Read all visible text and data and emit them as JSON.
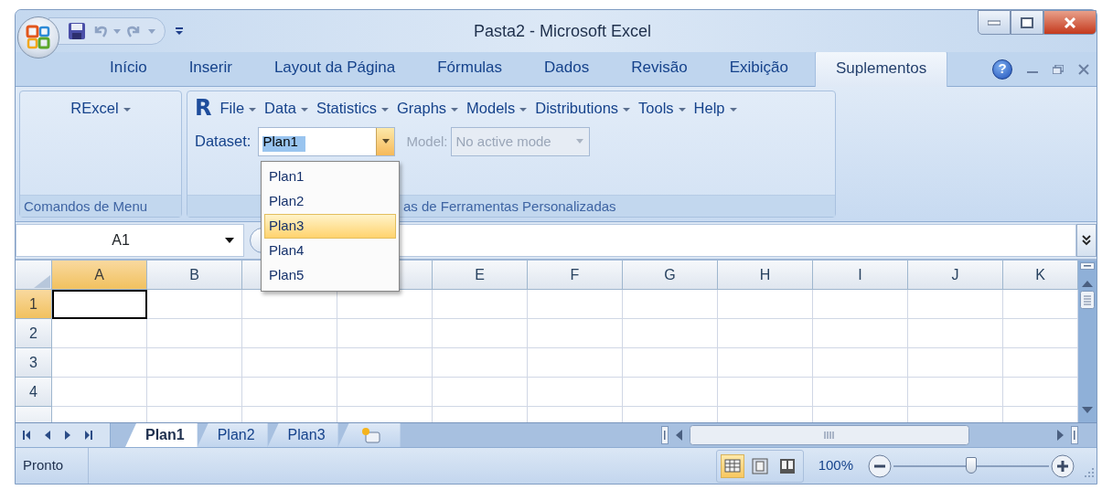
{
  "window": {
    "title": "Pasta2 - Microsoft Excel"
  },
  "help": {
    "glyph": "?"
  },
  "ribbon_tabs": [
    {
      "label": "Início",
      "selected": false
    },
    {
      "label": "Inserir",
      "selected": false
    },
    {
      "label": "Layout da Página",
      "selected": false
    },
    {
      "label": "Fórmulas",
      "selected": false
    },
    {
      "label": "Dados",
      "selected": false
    },
    {
      "label": "Revisão",
      "selected": false
    },
    {
      "label": "Exibição",
      "selected": false
    },
    {
      "label": "Suplementos",
      "selected": true
    }
  ],
  "menu_group": {
    "button": "RExcel",
    "label": "Comandos de Menu"
  },
  "tools_group": {
    "logo": "R",
    "menus": [
      {
        "label": "File"
      },
      {
        "label": "Data"
      },
      {
        "label": "Statistics"
      },
      {
        "label": "Graphs"
      },
      {
        "label": "Models"
      },
      {
        "label": "Distributions"
      },
      {
        "label": "Tools"
      },
      {
        "label": "Help"
      }
    ],
    "dataset": {
      "label": "Dataset:",
      "value": "Plan1",
      "highlighted": true
    },
    "model": {
      "label": "Model:",
      "value": "No active mode",
      "disabled": true
    },
    "label": "as de Ferramentas Personalizadas"
  },
  "dataset_dropdown": {
    "items": [
      {
        "label": "Plan1",
        "selected": false
      },
      {
        "label": "Plan2",
        "selected": false
      },
      {
        "label": "Plan3",
        "selected": true
      },
      {
        "label": "Plan4",
        "selected": false
      },
      {
        "label": "Plan5",
        "selected": false
      }
    ]
  },
  "name_box": {
    "value": "A1"
  },
  "grid": {
    "columns": [
      {
        "label": "A",
        "selected": true
      },
      {
        "label": "B",
        "selected": false
      },
      {
        "kind": "covered"
      },
      {
        "kind": "covered"
      },
      {
        "label": "E",
        "selected": false
      },
      {
        "label": "F",
        "selected": false
      },
      {
        "label": "G",
        "selected": false
      },
      {
        "label": "H",
        "selected": false
      },
      {
        "label": "I",
        "selected": false
      },
      {
        "label": "J",
        "selected": false
      },
      {
        "label": "K",
        "selected": false
      }
    ],
    "rows": [
      {
        "label": "1",
        "selected": true
      },
      {
        "label": "2",
        "selected": false
      },
      {
        "label": "3",
        "selected": false
      },
      {
        "label": "4",
        "selected": false
      }
    ]
  },
  "sheet_tabs": [
    {
      "label": "Plan1",
      "selected": true
    },
    {
      "label": "Plan2",
      "selected": false
    },
    {
      "label": "Plan3",
      "selected": false
    }
  ],
  "status_bar": {
    "text": "Pronto",
    "views": [
      {
        "kind": "normal",
        "selected": true
      },
      {
        "kind": "page_layout",
        "selected": false
      },
      {
        "kind": "page_break",
        "selected": false
      }
    ],
    "zoom": "100%",
    "zoom_slider": {
      "level": 0.5
    }
  }
}
